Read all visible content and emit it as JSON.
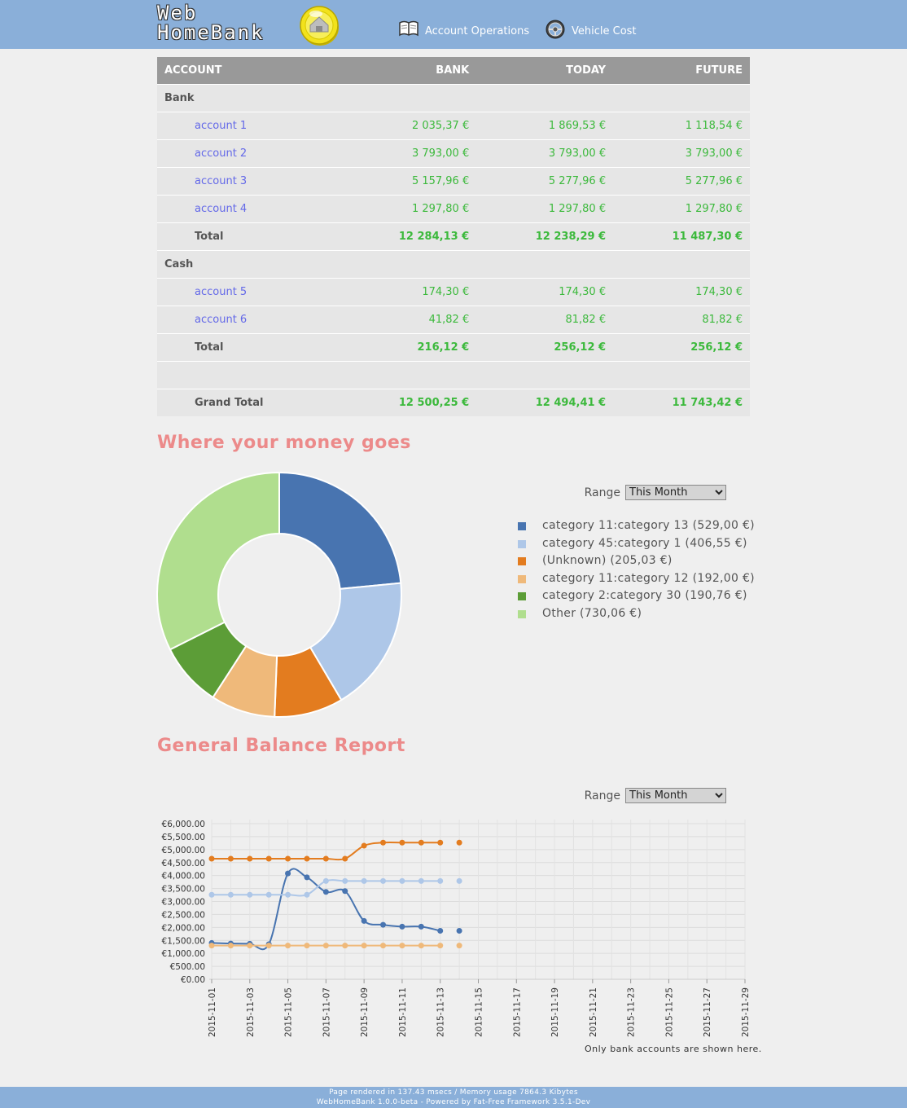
{
  "app": {
    "logo_line1": "Web",
    "logo_line2": "HomeBank"
  },
  "nav": {
    "items": [
      {
        "label": "Account Operations",
        "icon": "book-icon"
      },
      {
        "label": "Vehicle Cost",
        "icon": "steering-wheel-icon"
      }
    ]
  },
  "accounts": {
    "headers": {
      "account": "ACCOUNT",
      "bank": "BANK",
      "today": "TODAY",
      "future": "FUTURE"
    },
    "groups": [
      {
        "name": "Bank",
        "rows": [
          {
            "name": "account 1",
            "bank": "2 035,37 €",
            "today": "1 869,53 €",
            "future": "1 118,54 €"
          },
          {
            "name": "account 2",
            "bank": "3 793,00 €",
            "today": "3 793,00 €",
            "future": "3 793,00 €"
          },
          {
            "name": "account 3",
            "bank": "5 157,96 €",
            "today": "5 277,96 €",
            "future": "5 277,96 €"
          },
          {
            "name": "account 4",
            "bank": "1 297,80 €",
            "today": "1 297,80 €",
            "future": "1 297,80 €"
          }
        ],
        "total": {
          "label": "Total",
          "bank": "12 284,13 €",
          "today": "12 238,29 €",
          "future": "11 487,30 €"
        }
      },
      {
        "name": "Cash",
        "rows": [
          {
            "name": "account 5",
            "bank": "174,30 €",
            "today": "174,30 €",
            "future": "174,30 €"
          },
          {
            "name": "account 6",
            "bank": "41,82 €",
            "today": "81,82 €",
            "future": "81,82 €"
          }
        ],
        "total": {
          "label": "Total",
          "bank": "216,12 €",
          "today": "256,12 €",
          "future": "256,12 €"
        }
      }
    ],
    "grand_total": {
      "label": "Grand Total",
      "bank": "12 500,25 €",
      "today": "12 494,41 €",
      "future": "11 743,42 €"
    }
  },
  "spending": {
    "title": "Where your money goes",
    "range_label": "Range",
    "range_value": "This Month",
    "legend": [
      {
        "label": "category 11:category 13 (529,00 €)",
        "color": "#4874b0"
      },
      {
        "label": "category 45:category 1 (406,55 €)",
        "color": "#aec7e8"
      },
      {
        "label": "(Unknown) (205,03 €)",
        "color": "#e37c1f"
      },
      {
        "label": "category 11:category 12 (192,00 €)",
        "color": "#efb97a"
      },
      {
        "label": "category 2:category 30 (190,76 €)",
        "color": "#5c9d37"
      },
      {
        "label": "Other (730,06 €)",
        "color": "#b0de8e"
      }
    ]
  },
  "chart_data": {
    "type": "pie",
    "values": [
      529.0,
      406.55,
      205.03,
      192.0,
      190.76,
      730.06
    ],
    "categories": [
      "category 11:category 13",
      "category 45:category 1",
      "(Unknown)",
      "category 11:category 12",
      "category 2:category 30",
      "Other"
    ],
    "colors": [
      "#4874b0",
      "#aec7e8",
      "#e37c1f",
      "#efb97a",
      "#5c9d37",
      "#b0de8e"
    ],
    "donut": true
  },
  "balance": {
    "title": "General Balance Report",
    "range_label": "Range",
    "range_value": "This Month",
    "note": "Only bank accounts are shown here.",
    "chart": {
      "type": "line",
      "y_ticks": [
        "€0.00",
        "€500.00",
        "€1,000.00",
        "€1,500.00",
        "€2,000.00",
        "€2,500.00",
        "€3,000.00",
        "€3,500.00",
        "€4,000.00",
        "€4,500.00",
        "€5,000.00",
        "€5,500.00",
        "€6,000.00"
      ],
      "x_ticks": [
        "2015-11-01",
        "2015-11-03",
        "2015-11-05",
        "2015-11-07",
        "2015-11-09",
        "2015-11-11",
        "2015-11-13",
        "2015-11-15",
        "2015-11-17",
        "2015-11-19",
        "2015-11-21",
        "2015-11-23",
        "2015-11-25",
        "2015-11-27",
        "2015-11-29"
      ],
      "ylim": [
        0,
        6000
      ],
      "xlim": [
        "2015-11-01",
        "2015-11-29"
      ],
      "grid": true,
      "series": [
        {
          "color": "#4874b0",
          "x": [
            "2015-11-01",
            "2015-11-02",
            "2015-11-03",
            "2015-11-04",
            "2015-11-05",
            "2015-11-06",
            "2015-11-07",
            "2015-11-08",
            "2015-11-09",
            "2015-11-10",
            "2015-11-11",
            "2015-11-12",
            "2015-11-13",
            "2015-11-14"
          ],
          "y": [
            1400,
            1380,
            1370,
            1350,
            4080,
            3930,
            3370,
            3400,
            2250,
            2100,
            2030,
            2030,
            1870,
            1870
          ]
        },
        {
          "color": "#aec7e8",
          "x": [
            "2015-11-01",
            "2015-11-02",
            "2015-11-03",
            "2015-11-04",
            "2015-11-05",
            "2015-11-06",
            "2015-11-07",
            "2015-11-08",
            "2015-11-09",
            "2015-11-10",
            "2015-11-11",
            "2015-11-12",
            "2015-11-13",
            "2015-11-14"
          ],
          "y": [
            3260,
            3260,
            3260,
            3260,
            3260,
            3260,
            3790,
            3790,
            3790,
            3790,
            3790,
            3790,
            3790,
            3790
          ]
        },
        {
          "color": "#e37c1f",
          "x": [
            "2015-11-01",
            "2015-11-02",
            "2015-11-03",
            "2015-11-04",
            "2015-11-05",
            "2015-11-06",
            "2015-11-07",
            "2015-11-08",
            "2015-11-09",
            "2015-11-10",
            "2015-11-11",
            "2015-11-12",
            "2015-11-13",
            "2015-11-14"
          ],
          "y": [
            4650,
            4650,
            4650,
            4650,
            4650,
            4650,
            4650,
            4650,
            5150,
            5270,
            5270,
            5270,
            5270,
            5270
          ]
        },
        {
          "color": "#efb97a",
          "x": [
            "2015-11-01",
            "2015-11-02",
            "2015-11-03",
            "2015-11-04",
            "2015-11-05",
            "2015-11-06",
            "2015-11-07",
            "2015-11-08",
            "2015-11-09",
            "2015-11-10",
            "2015-11-11",
            "2015-11-12",
            "2015-11-13",
            "2015-11-14"
          ],
          "y": [
            1300,
            1300,
            1300,
            1300,
            1300,
            1300,
            1300,
            1300,
            1300,
            1300,
            1300,
            1300,
            1300,
            1300
          ]
        }
      ]
    }
  },
  "footer": {
    "line1": "Page rendered in 137.43 msecs / Memory usage 7864.3 Kibytes",
    "line2": "WebHomeBank 1.0.0-beta - Powered by Fat-Free Framework 3.5.1-Dev"
  }
}
